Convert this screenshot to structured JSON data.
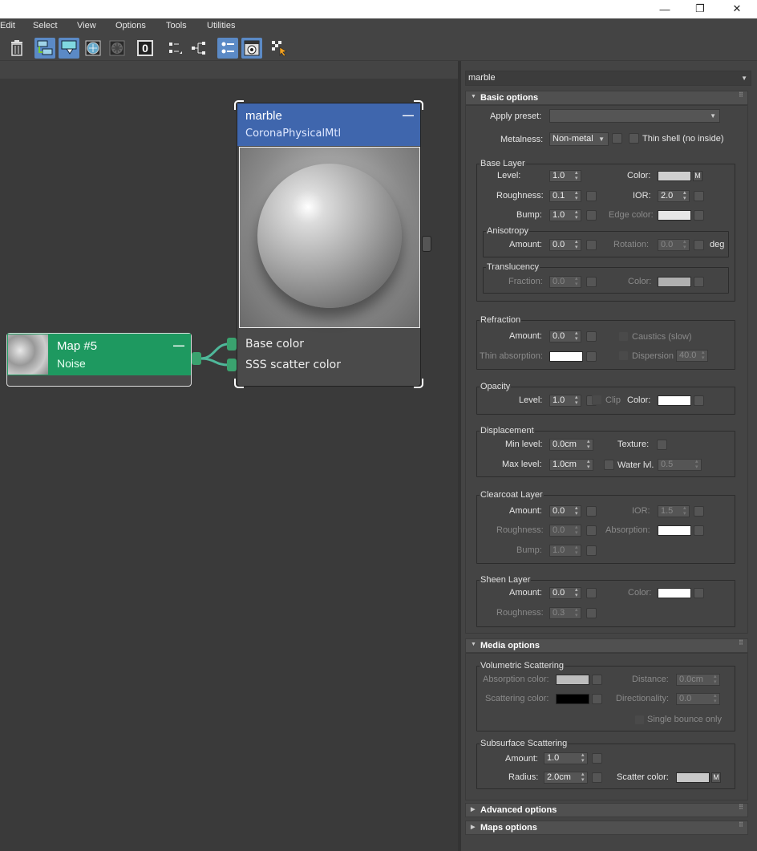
{
  "window": {
    "minimize": "—",
    "maximize": "❐",
    "close": "✕"
  },
  "menu": [
    "Edit",
    "Select",
    "View",
    "Options",
    "Tools",
    "Utilities"
  ],
  "toolbar": {
    "zero_label": "0"
  },
  "material_combo": "marble",
  "node_material": {
    "title": "marble",
    "subtitle": "CoronaPhysicalMtl",
    "collapse": "—",
    "slots": [
      "Base color",
      "SSS scatter color"
    ]
  },
  "node_map": {
    "title": "Map #5",
    "subtitle": "Noise",
    "collapse": "—"
  },
  "basic": {
    "title": "Basic options",
    "apply_preset": "Apply preset:",
    "metalness_label": "Metalness:",
    "metalness_value": "Non-metal",
    "thin_shell": "Thin shell (no inside)",
    "base_layer": {
      "title": "Base Layer",
      "level": "Level:",
      "level_v": "1.0",
      "color": "Color:",
      "m": "M",
      "roughness": "Roughness:",
      "roughness_v": "0.1",
      "ior": "IOR:",
      "ior_v": "2.0",
      "bump": "Bump:",
      "bump_v": "1.0",
      "edge_color": "Edge color:"
    },
    "anisotropy": {
      "title": "Anisotropy",
      "amount": "Amount:",
      "amount_v": "0.0",
      "rotation": "Rotation:",
      "rotation_v": "0.0",
      "deg": "deg"
    },
    "translucency": {
      "title": "Translucency",
      "fraction": "Fraction:",
      "fraction_v": "0.0",
      "color": "Color:"
    },
    "refraction": {
      "title": "Refraction",
      "amount": "Amount:",
      "amount_v": "0.0",
      "caustics": "Caustics (slow)",
      "thin_abs": "Thin absorption:",
      "dispersion": "Dispersion",
      "dispersion_v": "40.0"
    },
    "opacity": {
      "title": "Opacity",
      "level": "Level:",
      "level_v": "1.0",
      "clip": "Clip",
      "color": "Color:"
    },
    "displacement": {
      "title": "Displacement",
      "min": "Min level:",
      "min_v": "0.0cm",
      "texture": "Texture:",
      "max": "Max level:",
      "max_v": "1.0cm",
      "water": "Water lvl.",
      "water_v": "0.5"
    },
    "clearcoat": {
      "title": "Clearcoat Layer",
      "amount": "Amount:",
      "amount_v": "0.0",
      "ior": "IOR:",
      "ior_v": "1.5",
      "roughness": "Roughness:",
      "roughness_v": "0.0",
      "absorption": "Absorption:",
      "bump": "Bump:",
      "bump_v": "1.0"
    },
    "sheen": {
      "title": "Sheen Layer",
      "amount": "Amount:",
      "amount_v": "0.0",
      "color": "Color:",
      "roughness": "Roughness:",
      "roughness_v": "0.3"
    }
  },
  "media": {
    "title": "Media options",
    "vol": {
      "title": "Volumetric Scattering",
      "abs_color": "Absorption color:",
      "distance": "Distance:",
      "distance_v": "0.0cm",
      "scat_color": "Scattering color:",
      "direct": "Directionality:",
      "direct_v": "0.0",
      "single": "Single bounce only"
    },
    "sss": {
      "title": "Subsurface Scattering",
      "amount": "Amount:",
      "amount_v": "1.0",
      "radius": "Radius:",
      "radius_v": "2.0cm",
      "scatter_color": "Scatter color:",
      "m": "M"
    }
  },
  "advanced": "Advanced options",
  "maps": "Maps options",
  "colors": {
    "material_header": "#3f66ad",
    "map_header": "#1e9960",
    "wire": "#4fb89a"
  }
}
